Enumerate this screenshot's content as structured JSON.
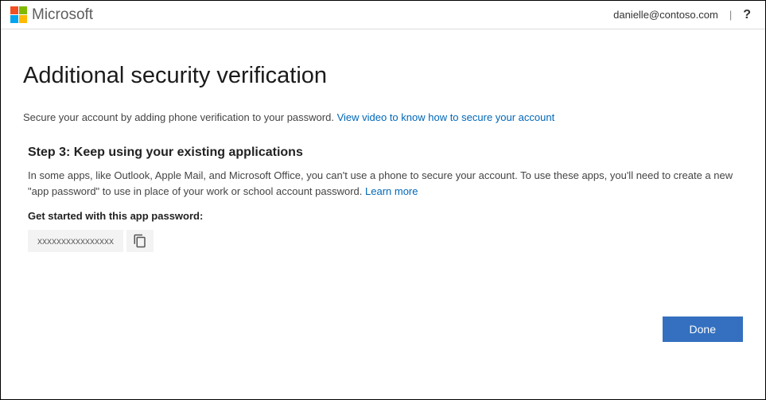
{
  "header": {
    "brand": "Microsoft",
    "user_email": "danielle@contoso.com",
    "help_label": "?"
  },
  "page": {
    "title": "Additional security verification",
    "subtitle_text": "Secure your account by adding phone verification to your password. ",
    "subtitle_link": "View video to know how to secure your account"
  },
  "step": {
    "title": "Step 3: Keep using your existing applications",
    "body_text": "In some apps, like Outlook, Apple Mail, and Microsoft Office, you can't use a phone to secure your account. To use these apps, you'll need to create a new \"app password\" to use in place of your work or school account password. ",
    "learn_more": "Learn more",
    "get_started_label": "Get started with this app password:",
    "app_password": "xxxxxxxxxxxxxxxx"
  },
  "buttons": {
    "done": "Done"
  }
}
